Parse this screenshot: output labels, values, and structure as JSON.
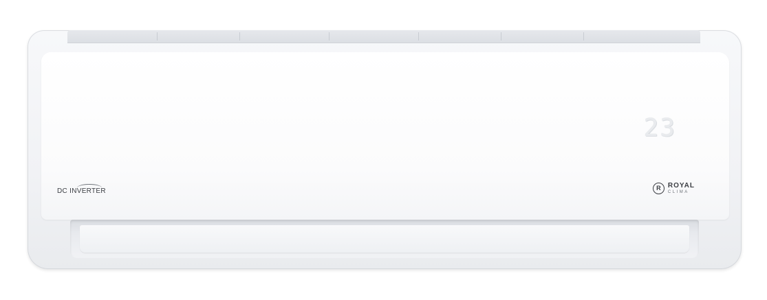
{
  "display": {
    "temperature": "23"
  },
  "badges": {
    "inverter": "DC INVERTER"
  },
  "brand": {
    "mark": "R",
    "name": "ROYAL",
    "sub": "CLIMA"
  },
  "colors": {
    "body": "#f3f4f6",
    "text": "#3a3d42"
  }
}
